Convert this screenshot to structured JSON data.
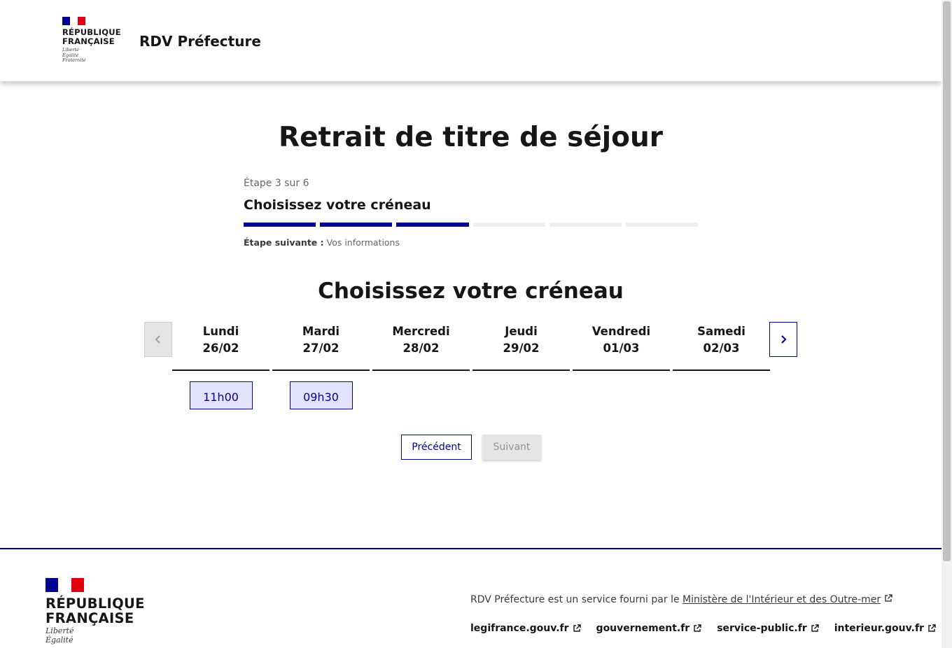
{
  "header": {
    "logo_lines": [
      "RÉPUBLIQUE",
      "FRANÇAISE"
    ],
    "motto_lines": [
      "Liberté",
      "Égalité",
      "Fraternité"
    ],
    "service_name": "RDV Préfecture"
  },
  "main": {
    "title": "Retrait de titre de séjour",
    "step_count": "Étape 3 sur 6",
    "step_title": "Choisissez votre créneau",
    "stepper": {
      "total": 6,
      "current": 3
    },
    "next_step_label": "Étape suivante :",
    "next_step_value": "Vos informations"
  },
  "calendar": {
    "title": "Choisissez votre créneau",
    "prev_icon": "chevron-left-icon",
    "next_icon": "chevron-right-icon",
    "days": [
      {
        "name": "Lundi",
        "date": "26/02",
        "slots": [
          "11h00"
        ]
      },
      {
        "name": "Mardi",
        "date": "27/02",
        "slots": [
          "09h30"
        ]
      },
      {
        "name": "Mercredi",
        "date": "28/02",
        "slots": []
      },
      {
        "name": "Jeudi",
        "date": "29/02",
        "slots": []
      },
      {
        "name": "Vendredi",
        "date": "01/03",
        "slots": []
      },
      {
        "name": "Samedi",
        "date": "02/03",
        "slots": []
      }
    ]
  },
  "actions": {
    "previous_label": "Précédent",
    "next_label": "Suivant"
  },
  "footer": {
    "logo_lines": [
      "RÉPUBLIQUE",
      "FRANÇAISE"
    ],
    "motto_lines": [
      "Liberté",
      "Égalité"
    ],
    "description_prefix": "RDV Préfecture est un service fourni par le",
    "ministry_link": "Ministère de l'Intérieur et des Outre-mer",
    "links": [
      "legifrance.gouv.fr",
      "gouvernement.fr",
      "service-public.fr",
      "interieur.gouv.fr"
    ]
  },
  "colors": {
    "primary": "#000091",
    "red": "#e1000f",
    "slot_bg": "#e3e3fd",
    "disabled_bg": "#e5e5e5"
  }
}
